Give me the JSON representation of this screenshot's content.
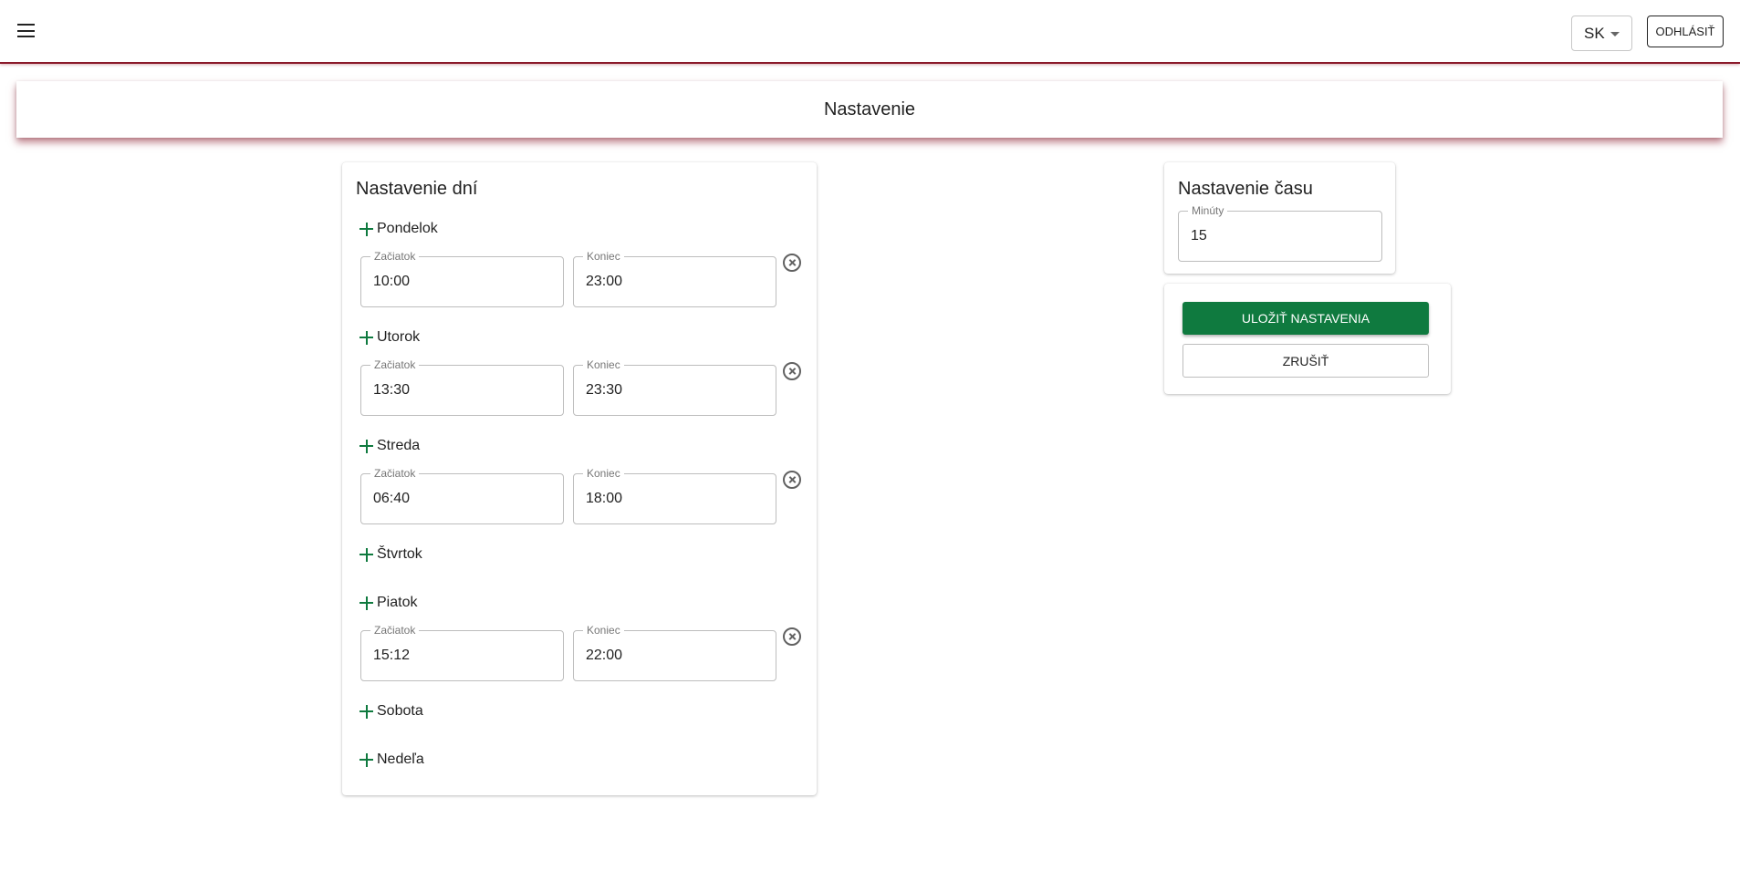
{
  "topbar": {
    "menu_icon": "hamburger-menu-icon",
    "language": "SK",
    "logout_label": "ODHLÁSIŤ"
  },
  "page": {
    "title": "Nastavenie"
  },
  "days_settings": {
    "title": "Nastavenie dní",
    "start_label": "Začiatok",
    "end_label": "Koniec",
    "add_icon": "plus-icon",
    "clear_icon": "close-circle-icon",
    "days": [
      {
        "name": "Pondelok",
        "start": "10:00",
        "end": "23:00"
      },
      {
        "name": "Utorok",
        "start": "13:30",
        "end": "23:30"
      },
      {
        "name": "Streda",
        "start": "06:40",
        "end": "18:00"
      },
      {
        "name": "Štvrtok"
      },
      {
        "name": "Piatok",
        "start": "15:12",
        "end": "22:00"
      },
      {
        "name": "Sobota"
      },
      {
        "name": "Nedeľa"
      }
    ]
  },
  "time_settings": {
    "title": "Nastavenie času",
    "minutes_label": "Minúty",
    "minutes_value": "15"
  },
  "actions": {
    "save_label": "ULOŽIŤ NASTAVENIA",
    "cancel_label": "ZRUŠIŤ"
  },
  "colors": {
    "accent_green": "#0f7a3f",
    "brand_maroon": "#8b1a2b"
  }
}
